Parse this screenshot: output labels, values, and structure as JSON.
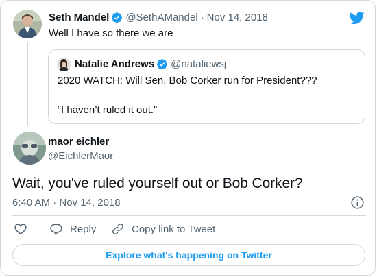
{
  "colors": {
    "accent": "#1d9bf0",
    "text": "#0f1419",
    "secondary": "#536471",
    "border": "#cfd9de"
  },
  "parent_tweet": {
    "author_name": "Seth Mandel",
    "handle": "@SethAMandel",
    "separator": "·",
    "date": "Nov 14, 2018",
    "text": "Well I have so there we are",
    "verified_icon": "verified-badge-icon"
  },
  "quoted_tweet": {
    "author_name": "Natalie Andrews",
    "handle": "@nataliewsj",
    "line1": "2020 WATCH: Will Sen. Bob Corker run for President???",
    "line2": "“I haven’t ruled it out.”",
    "verified_icon": "verified-badge-icon"
  },
  "main_tweet": {
    "author_name": "maor eichler",
    "handle": "@EichlerMaor",
    "text": "Wait, you've ruled yourself out or Bob Corker?",
    "timestamp": "6:40 AM · Nov 14, 2018"
  },
  "actions": {
    "like_icon": "heart-icon",
    "reply_label": "Reply",
    "copy_label": "Copy link to Tweet"
  },
  "explore_label": "Explore what's happening on Twitter",
  "brand_icon": "twitter-bird-icon"
}
